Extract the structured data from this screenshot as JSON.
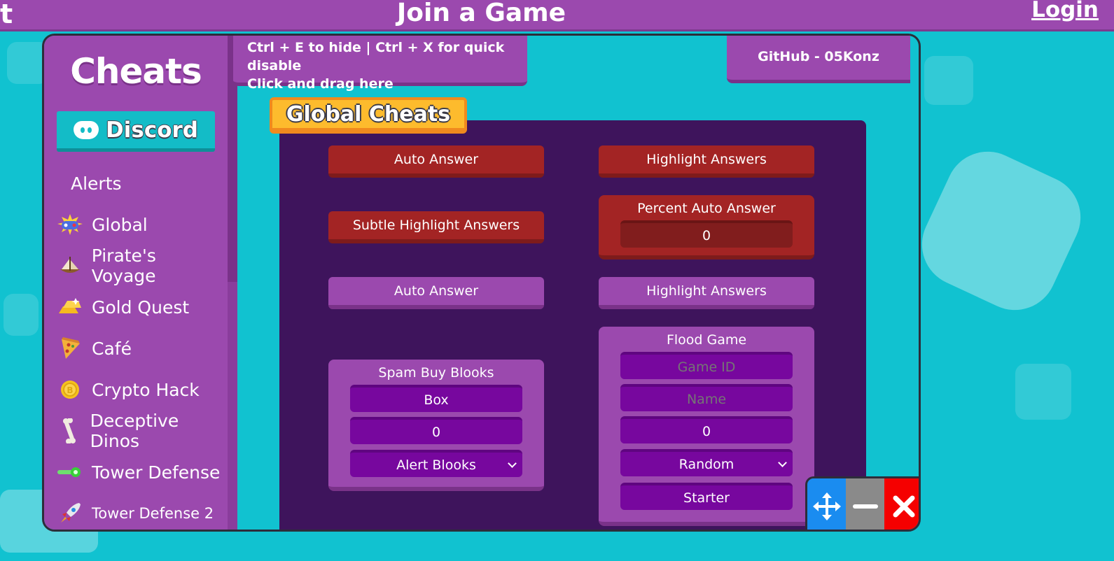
{
  "topbar": {
    "logo_fragment": "t",
    "title": "Join a Game",
    "login": "Login"
  },
  "sidebar": {
    "title": "Cheats",
    "discord": "Discord",
    "items": [
      {
        "label": "Alerts",
        "icon": "none"
      },
      {
        "label": "Global",
        "icon": "gamepad-icon"
      },
      {
        "label": "Pirate's Voyage",
        "icon": "ship-icon"
      },
      {
        "label": "Gold Quest",
        "icon": "gold-bars-icon"
      },
      {
        "label": "Café",
        "icon": "pizza-icon"
      },
      {
        "label": "Crypto Hack",
        "icon": "coin-icon"
      },
      {
        "label": "Deceptive Dinos",
        "icon": "bone-icon"
      },
      {
        "label": "Tower Defense",
        "icon": "laser-icon"
      },
      {
        "label": "Tower Defense 2",
        "icon": "rocket-icon"
      }
    ]
  },
  "info": {
    "line1": "Ctrl + E to hide | Ctrl + X for quick disable",
    "line2": "Click and drag here"
  },
  "github": "GitHub - 05Konz",
  "section": "Global Cheats",
  "cheats": {
    "auto_answer_red": "Auto Answer",
    "highlight_answers_red": "Highlight Answers",
    "subtle_highlight": "Subtle Highlight Answers",
    "percent_auto_answer": {
      "title": "Percent Auto Answer",
      "value": "0"
    },
    "auto_answer_purple": "Auto Answer",
    "highlight_answers_purple": "Highlight Answers",
    "spam_buy": {
      "title": "Spam Buy Blooks",
      "box_value": "Box",
      "amount_value": "0",
      "alert_select": "Alert Blooks"
    },
    "flood": {
      "title": "Flood Game",
      "game_id_placeholder": "Game ID",
      "name_placeholder": "Name",
      "amount_value": "0",
      "mode_select": "Random",
      "starter_select": "Starter"
    }
  },
  "colors": {
    "accent_purple": "#9b49ae",
    "content_bg": "#3e145c",
    "red_button": "#a32424",
    "background_teal": "#11c2d0",
    "close_red": "#f50000",
    "move_blue": "#1a8cf0"
  }
}
